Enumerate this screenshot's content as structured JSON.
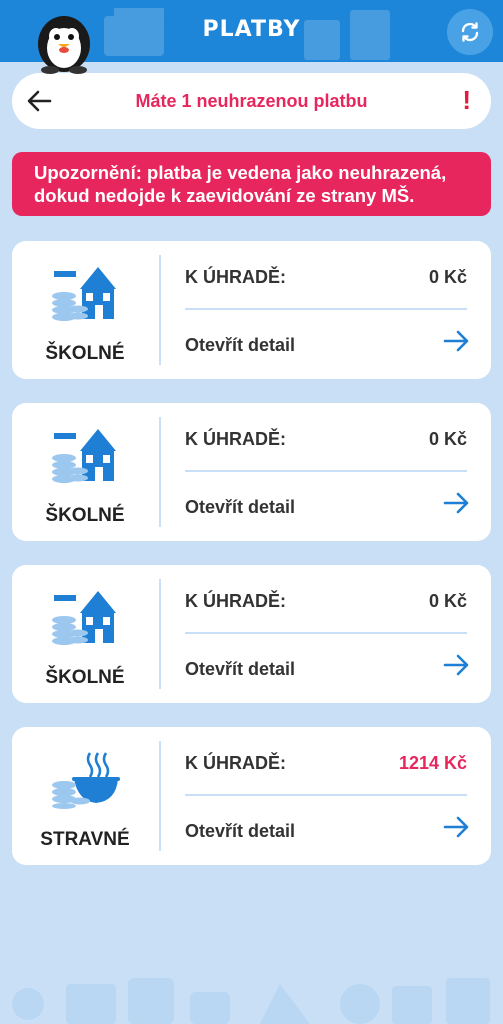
{
  "header": {
    "title": "PLATBY",
    "refresh_icon": "refresh-icon",
    "mascot_icon": "penguin-mascot"
  },
  "notice": {
    "back_icon": "back-arrow-icon",
    "text": "Máte 1 neuhrazenou platbu",
    "mark": "!"
  },
  "warning": {
    "text": "Upozornění: platba je vedena jako neuhrazená, dokud nedojde k zaevidování ze strany MŠ."
  },
  "cards": [
    {
      "type": "ŠKOLNÉ",
      "icon": "school-fee-icon",
      "due_label": "K ÚHRADĚ:",
      "amount": "0 Kč",
      "detail": "Otevřít detail"
    },
    {
      "type": "ŠKOLNÉ",
      "icon": "school-fee-icon",
      "due_label": "K ÚHRADĚ:",
      "amount": "0 Kč",
      "detail": "Otevřít detail"
    },
    {
      "type": "ŠKOLNÉ",
      "icon": "school-fee-icon",
      "due_label": "K ÚHRADĚ:",
      "amount": "0 Kč",
      "detail": "Otevřít detail"
    },
    {
      "type": "STRAVNÉ",
      "icon": "meal-fee-icon",
      "due_label": "K ÚHRADĚ:",
      "amount": "1214 Kč",
      "detail": "Otevřít detail"
    }
  ],
  "colors": {
    "header": "#1e86d9",
    "background": "#c9dff5",
    "alert": "#e8265e",
    "icon_blue": "#1e7fd4"
  }
}
